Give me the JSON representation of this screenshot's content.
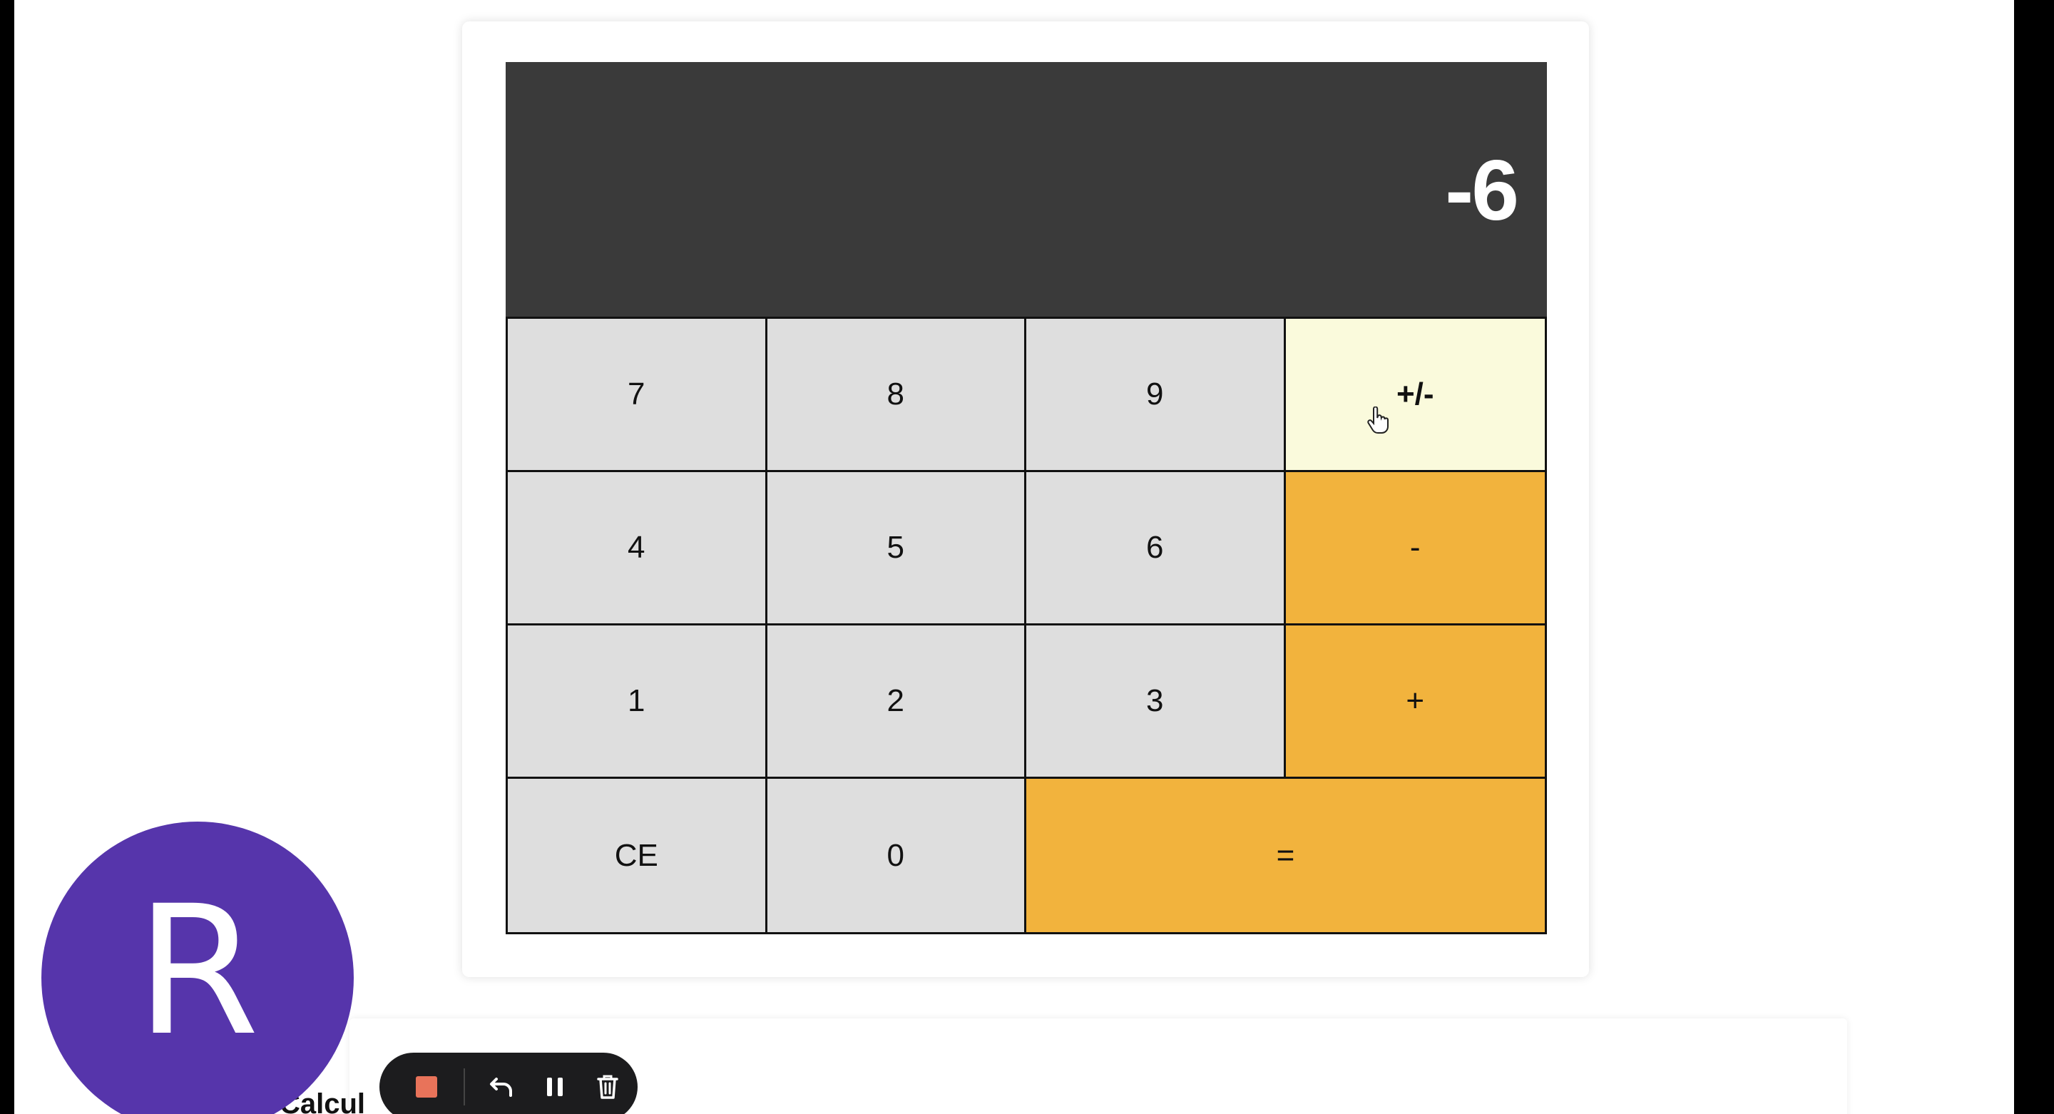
{
  "display": {
    "value": "-6"
  },
  "keypad": {
    "rows": [
      [
        {
          "label": "7"
        },
        {
          "label": "8"
        },
        {
          "label": "9"
        },
        {
          "label": "+/-"
        }
      ],
      [
        {
          "label": "4"
        },
        {
          "label": "5"
        },
        {
          "label": "6"
        },
        {
          "label": "-"
        }
      ],
      [
        {
          "label": "1"
        },
        {
          "label": "2"
        },
        {
          "label": "3"
        },
        {
          "label": "+"
        }
      ],
      [
        {
          "label": "CE"
        },
        {
          "label": "0"
        },
        {
          "label": "="
        }
      ]
    ]
  },
  "avatar": {
    "initial": "R",
    "color": "#5635ab"
  },
  "bottom_panel": {
    "title": "Calcul"
  },
  "recorder": {
    "stop_icon": "stop-icon",
    "undo_icon": "undo-icon",
    "pause_icon": "pause-icon",
    "delete_icon": "trash-icon"
  },
  "colors": {
    "display_bg": "#3a3a3a",
    "key_bg": "#dedede",
    "operator_bg": "#f2b33d",
    "highlight_bg": "#fafadc",
    "stop_red": "#e8735a"
  }
}
